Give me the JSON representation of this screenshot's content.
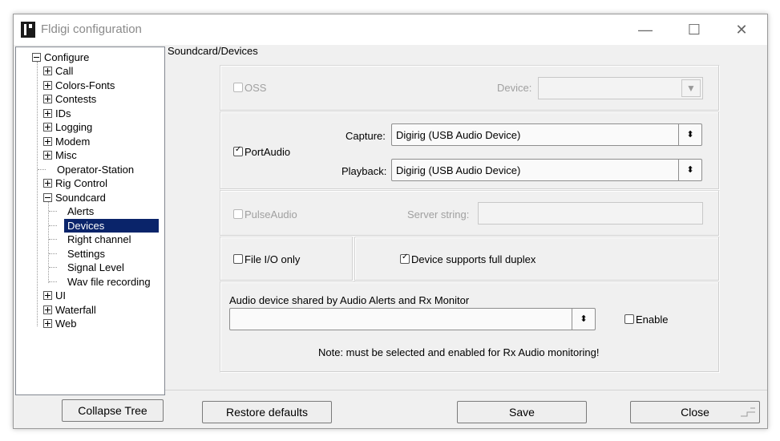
{
  "window": {
    "title": "Fldigi configuration",
    "minimize_glyph": "—",
    "maximize_glyph": "☐",
    "close_glyph": "✕"
  },
  "tree": {
    "root": "Configure",
    "items": {
      "call": "Call",
      "colors_fonts": "Colors-Fonts",
      "contests": "Contests",
      "ids": "IDs",
      "logging": "Logging",
      "modem": "Modem",
      "misc": "Misc",
      "operator_station": "Operator-Station",
      "rig_control": "Rig Control",
      "soundcard": "Soundcard",
      "alerts": "Alerts",
      "devices": "Devices",
      "right_channel": "Right channel",
      "settings": "Settings",
      "signal_level": "Signal Level",
      "wav_recording": "Wav file recording",
      "ui": "UI",
      "waterfall": "Waterfall",
      "web": "Web"
    }
  },
  "panel": {
    "heading": "Soundcard/Devices",
    "oss": {
      "label": "OSS",
      "checked": false,
      "device_label": "Device:",
      "device_value": "",
      "arrow_glyph": "▼"
    },
    "portaudio": {
      "label": "PortAudio",
      "checked": true,
      "capture_label": "Capture:",
      "capture_value": "Digirig (USB Audio Device)",
      "playback_label": "Playback:",
      "playback_value": "Digirig (USB Audio Device)",
      "spin_glyph": "⬍"
    },
    "pulseaudio": {
      "label": "PulseAudio",
      "checked": false,
      "server_label": "Server string:",
      "server_value": ""
    },
    "fileio": {
      "label": "File I/O only",
      "checked": false
    },
    "duplex": {
      "label": "Device supports full duplex",
      "checked": true
    },
    "shared": {
      "label": "Audio device shared by Audio Alerts and Rx Monitor",
      "value": "",
      "enable_label": "Enable",
      "enable_checked": false,
      "note": "Note: must be selected and enabled for Rx Audio monitoring!"
    }
  },
  "buttons": {
    "collapse_tree": "Collapse Tree",
    "restore_defaults": "Restore defaults",
    "save": "Save",
    "close": "Close"
  },
  "colors": {
    "selection": "#0a246a",
    "window_bg": "#f0f0f0"
  }
}
